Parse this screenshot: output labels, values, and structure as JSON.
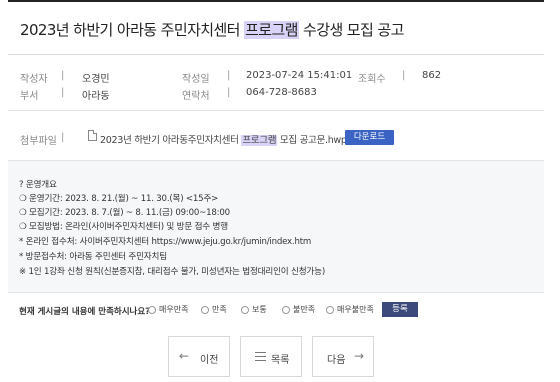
{
  "post": {
    "title_pre": "2023년 하반기 아라동 주민자치센터 ",
    "title_hl": "프로그램",
    "title_post": " 수강생 모집 공고"
  },
  "meta": {
    "author_label": "작성자",
    "author": "오경민",
    "date_label": "작성일",
    "date": "2023-07-24 15:41:01",
    "views_label": "조회수",
    "views": "862",
    "dept_label": "부서",
    "dept": "아라동",
    "contact_label": "연락처",
    "contact": "064-728-8683",
    "sep": "|"
  },
  "attachment": {
    "label": "첨부파일",
    "file_pre": "2023년 하반기 아라동주민자치센터 ",
    "file_hl": "프로그램",
    "file_post": " 모집 공고문.hwp",
    "download_label": "다운로드"
  },
  "content": {
    "lines": [
      "? 운영개요",
      "❍ 운영기간: 2023. 8. 21.(월) ~ 11. 30.(목) <15주>",
      "❍ 모집기간: 2023. 8. 7.(월) ~ 8. 11.(금) 09:00~18:00",
      "❍ 모집방법: 온라인(사이버주민자치센터) 및 방문 접수 병행",
      "* 온라인 접수처: 사이버주민자치센터 https://www.jeju.go.kr/jumin/index.htm",
      "* 방문접수처: 아라동 주민센터 주민자치팀",
      "※ 1인 1강좌 신청 원칙(신분증지참, 대리접수 불가, 미성년자는 법정대리인이 신청가능)"
    ]
  },
  "survey": {
    "question": "현재 게시글의 내용에 만족하시나요?",
    "options": [
      "매우만족",
      "만족",
      "보통",
      "불만족",
      "매우불만족"
    ],
    "submit_label": "등록"
  },
  "nav": {
    "prev_label": "이전",
    "list_label": "목록",
    "next_label": "다음",
    "prev_icon": "←",
    "next_icon": "→"
  }
}
